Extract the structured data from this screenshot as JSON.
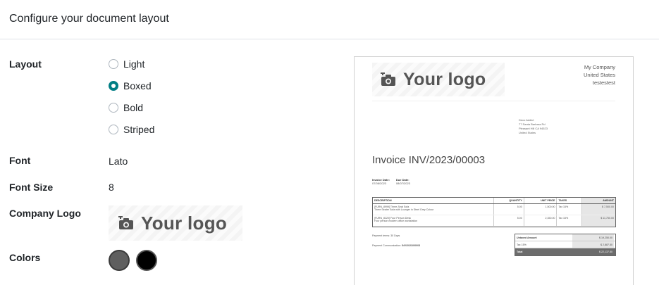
{
  "header": {
    "title": "Configure your document layout"
  },
  "fields": {
    "layout_label": "Layout",
    "font_label": "Font",
    "font_value": "Lato",
    "font_size_label": "Font Size",
    "font_size_value": "8",
    "company_logo_label": "Company Logo",
    "colors_label": "Colors"
  },
  "layout_options": [
    {
      "label": "Light",
      "checked": false
    },
    {
      "label": "Boxed",
      "checked": true
    },
    {
      "label": "Bold",
      "checked": false
    },
    {
      "label": "Striped",
      "checked": false
    }
  ],
  "logo": {
    "text": "Your logo",
    "icon": "camera-add-icon"
  },
  "colors": {
    "primary": "#5f5f5f",
    "secondary": "#000000",
    "accent": "#017e84"
  },
  "preview": {
    "logo_text": "Your logo",
    "company_lines": [
      "My Company",
      "United States",
      "testestest"
    ],
    "address_lines": [
      "Deco Addict",
      "77 Santa Barbara Rd",
      "Pleasant Hill CA 94523",
      "United States"
    ],
    "invoice_title": "Invoice INV/2023/00003",
    "invoice_date_label": "Invoice Date:",
    "invoice_date": "07/08/2023",
    "due_date_label": "Due Date:",
    "due_date": "08/07/2023",
    "table_headers": [
      "DESCRIPTION",
      "QUANTITY",
      "UNIT PRICE",
      "TAXES",
      "AMOUNT"
    ],
    "table_rows": [
      {
        "desc": "[FURN_8999] Three-Seat Sofa",
        "desc2": "Three Seater Sofa with Lounger in Steel Grey Colour",
        "qty": "5.00",
        "price": "1,500.00",
        "tax": "Tax 15%",
        "amount": "$ 7,500.00"
      },
      {
        "desc": "[FURN_8220] Four Person Desk",
        "desc2": "Four person modern office workstation",
        "qty": "5.00",
        "price": "2,350.00",
        "tax": "Tax 15%",
        "amount": "$ 11,750.00"
      }
    ],
    "payment_terms": "Payment terms: 30 Days",
    "payment_comm_label": "Payment Communication:",
    "payment_comm": "INV/2023/00003",
    "untaxed_label": "Untaxed Amount",
    "untaxed": "$ 19,250.00",
    "tax_label": "Tax 15%",
    "tax": "$ 2,887.50",
    "total_label": "Total",
    "total": "$ 22,137.50"
  }
}
